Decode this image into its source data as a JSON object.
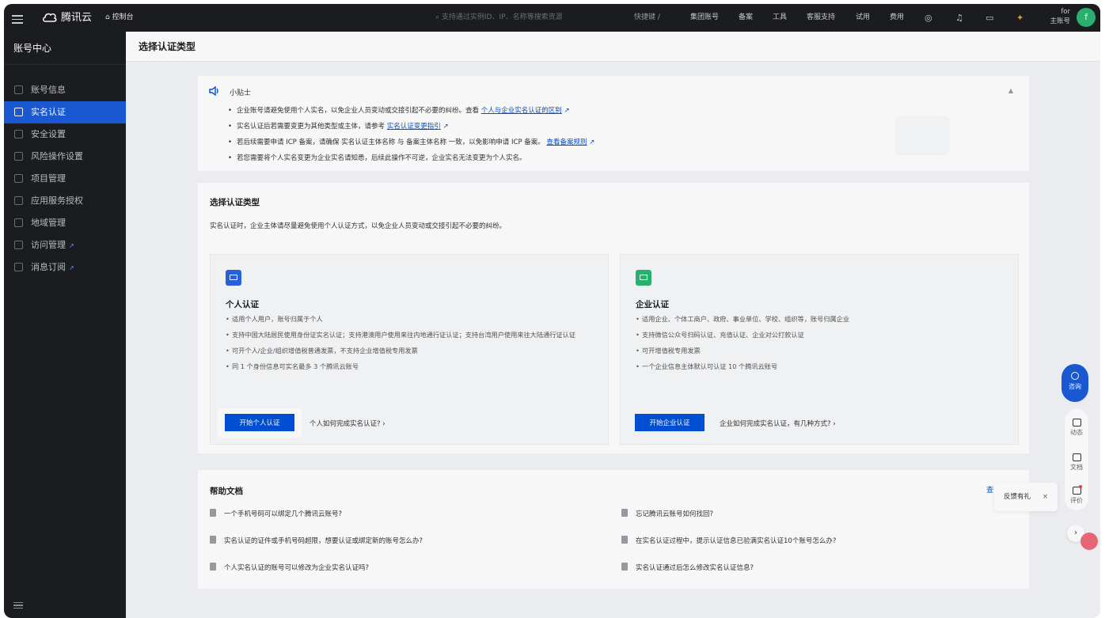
{
  "topbar": {
    "logo": "腾讯云",
    "console": "控制台",
    "search_placeholder": "支持通过实例ID、IP、名称等搜索资源",
    "shortcut": "快捷键 /",
    "nav": [
      "集团账号",
      "备案",
      "工具",
      "客服支持",
      "试用",
      "费用"
    ],
    "account_top": "for",
    "account_bottom": "主账号",
    "avatar": "f"
  },
  "sidebar": {
    "title": "账号中心",
    "items": [
      {
        "label": "账号信息",
        "active": false
      },
      {
        "label": "实名认证",
        "active": true
      },
      {
        "label": "安全设置",
        "active": false
      },
      {
        "label": "风险操作设置",
        "active": false
      },
      {
        "label": "项目管理",
        "active": false
      },
      {
        "label": "应用服务授权",
        "active": false
      },
      {
        "label": "地域管理",
        "active": false
      },
      {
        "label": "访问管理",
        "active": false,
        "external": true
      },
      {
        "label": "消息订阅",
        "active": false,
        "external": true
      }
    ]
  },
  "header": {
    "title": "选择认证类型"
  },
  "tips": {
    "title": "小贴士",
    "items": [
      {
        "text": "企业账号请避免使用个人实名，以免企业人员变动或交接引起不必要的纠纷。查看 ",
        "link": "个人与企业实名认证的区别"
      },
      {
        "text": "实名认证后若需要变更为其他类型或主体，请参考 ",
        "link": "实名认证变更指引"
      },
      {
        "text": "若后续需要申请 ICP 备案，请确保 实名认证主体名称 与 备案主体名称 一致，以免影响申请 ICP 备案。 ",
        "link": "查看备案规则"
      },
      {
        "text": "若您需要将个人实名变更为企业实名请知悉，后续此操作不可逆，企业实名无法变更为个人实名。",
        "link": ""
      }
    ]
  },
  "choose": {
    "title": "选择认证类型",
    "desc": "实名认证时，企业主体请尽量避免使用个人认证方式，以免企业人员变动或交接引起不必要的纠纷。",
    "personal": {
      "title": "个人认证",
      "bullets": [
        "适用个人用户，账号归属于个人",
        "支持中国大陆居民使用身份证实名认证；支持港澳用户使用来往内地通行证认证；支持台湾用户使用来往大陆通行证认证",
        "可开个人/企业/组织增值税普通发票，不支持企业增值税专用发票",
        "同 1 个身份信息可实名最多 3 个腾讯云账号"
      ],
      "button": "开始个人认证",
      "link": "个人如何完成实名认证? ›"
    },
    "enterprise": {
      "title": "企业认证",
      "bullets": [
        "适用企业、个体工商户、政府、事业单位、学校、组织等，账号归属企业",
        "支持微信公众号扫码认证、充值认证、企业对公打款认证",
        "可开增值税专用发票",
        "一个企业信息主体默认可认证 10 个腾讯云账号"
      ],
      "button": "开始企业认证",
      "link": "企业如何完成实名认证，有几种方式? ›"
    }
  },
  "help": {
    "title": "帮助文档",
    "more": "查",
    "docs_left": [
      "一个手机号码可以绑定几个腾讯云账号?",
      "实名认证的证件或手机号码超限，想要认证或绑定新的账号怎么办?",
      "个人实名认证的账号可以修改为企业实名认证吗?"
    ],
    "docs_right": [
      "忘记腾讯云账号如何找回?",
      "在实名认证过程中，提示认证信息已验满实名认证10个账号怎么办?",
      "实名认证通过后怎么修改实名认证信息?"
    ]
  },
  "float": {
    "consult": "咨询",
    "dynamic": "动态",
    "docs": "文档",
    "review": "评价",
    "feedback": "反馈有礼",
    "close": "×",
    "expand": "›"
  },
  "colors": {
    "accent": "#0052d9",
    "sidebar_bg": "#1c1d20",
    "active": "#1b5bd8",
    "green": "#2bb673"
  }
}
